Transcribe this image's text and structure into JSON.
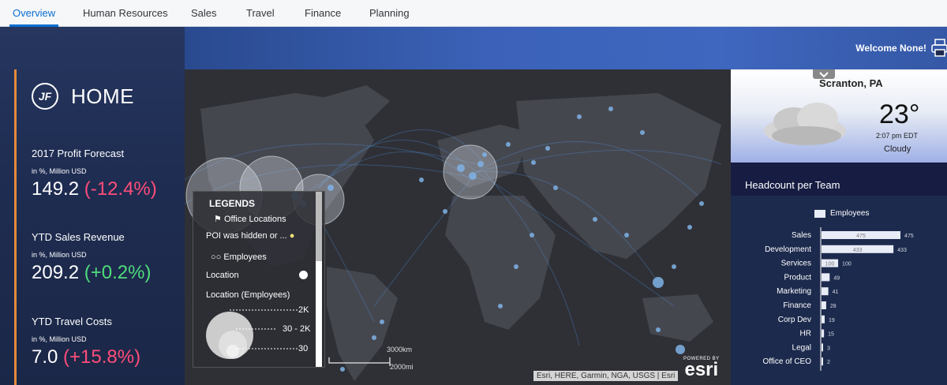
{
  "tabs": [
    {
      "label": "Overview",
      "active": true
    },
    {
      "label": "Human Resources",
      "active": false
    },
    {
      "label": "Sales",
      "active": false
    },
    {
      "label": "Travel",
      "active": false
    },
    {
      "label": "Finance",
      "active": false
    },
    {
      "label": "Planning",
      "active": false
    }
  ],
  "header": {
    "welcome": "Welcome None!",
    "print_icon": "printer-icon"
  },
  "home": {
    "logo_text": "JF",
    "title": "HOME"
  },
  "kpis": [
    {
      "label": "2017 Profit Forecast",
      "unit": "in %, Million USD",
      "value": "149.2",
      "change": "(-12.4%)",
      "trend": "neg"
    },
    {
      "label": "YTD Sales Revenue",
      "unit": "in %, Million USD",
      "value": "209.2",
      "change": "(+0.2%)",
      "trend": "pos"
    },
    {
      "label": "YTD Travel Costs",
      "unit": "in %, Million USD",
      "value": "7.0",
      "change": "(+15.8%)",
      "trend": "neg"
    }
  ],
  "map": {
    "legend": {
      "title": "LEGENDS",
      "office_locations": "Office Locations",
      "poi_hidden": "POI was hidden or ...",
      "employees": "Employees",
      "location": "Location",
      "location_employees": "Location (Employees)",
      "sizes": [
        "2K",
        "30 - 2K",
        "30"
      ]
    },
    "scale": {
      "km": "3000km",
      "mi": "2000mi"
    },
    "attribution": "Esri, HERE, Garmin, NGA, USGS | Esri",
    "powered_by": "POWERED BY",
    "esri": "esri"
  },
  "weather": {
    "city": "Scranton, PA",
    "temperature": "23°",
    "time": "2:07 pm EDT",
    "condition": "Cloudy"
  },
  "headcount": {
    "title": "Headcount per Team",
    "legend": "Employees",
    "colors": {
      "bar": "#e8ecf7",
      "text": "#ffffff"
    }
  },
  "chart_data": {
    "type": "bar",
    "orientation": "horizontal",
    "title": "Headcount per Team",
    "categories": [
      "Sales",
      "Development",
      "Services",
      "Product",
      "Marketing",
      "Finance",
      "Corp Dev",
      "HR",
      "Legal",
      "Office of CEO"
    ],
    "series": [
      {
        "name": "Employees",
        "values": [
          475,
          433,
          100,
          49,
          41,
          28,
          19,
          15,
          3,
          2
        ]
      }
    ],
    "xlim": [
      0,
      475
    ],
    "legend": "top"
  }
}
